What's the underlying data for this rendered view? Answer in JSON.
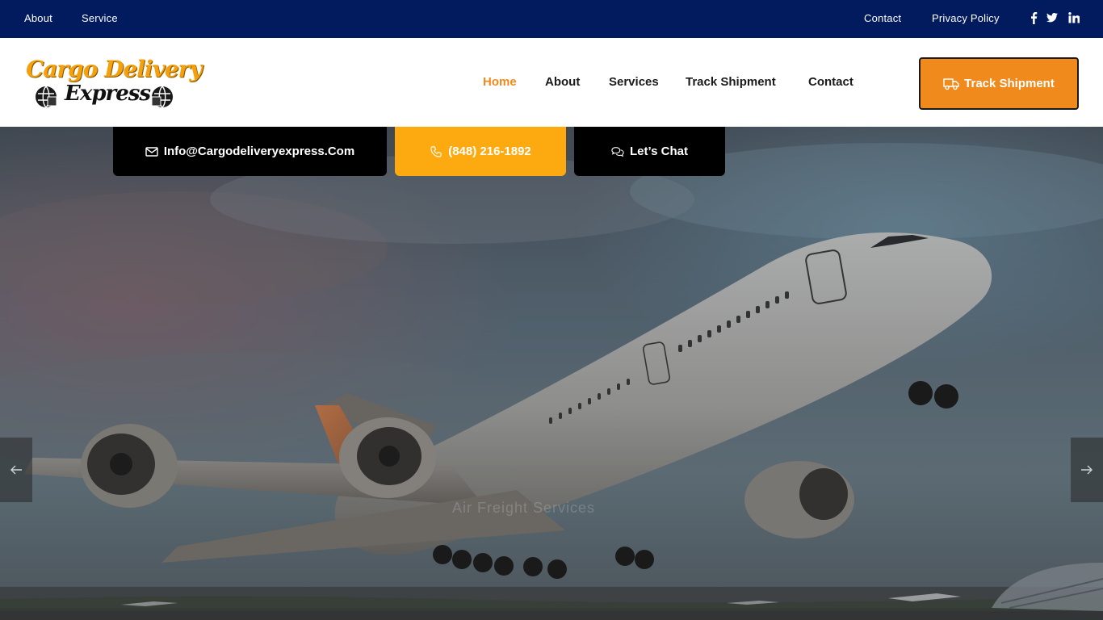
{
  "topbar": {
    "left_links": [
      "About",
      "Service"
    ],
    "right_links": [
      "Contact",
      "Privacy Policy"
    ],
    "social_icons": [
      "facebook-icon",
      "twitter-icon",
      "linkedin-icon"
    ],
    "bg_color": "#021b5e"
  },
  "logo": {
    "line1": "Cargo Delivery",
    "line2": "Express"
  },
  "nav": {
    "items": [
      {
        "label": "Home",
        "active": true
      },
      {
        "label": "About",
        "active": false
      },
      {
        "label": "Services",
        "active": false
      },
      {
        "label": "Track Shipment",
        "active": false
      },
      {
        "label": "Contact",
        "active": false
      }
    ],
    "accent_color": "#f08a1c"
  },
  "cta": {
    "track_label": "Track Shipment",
    "icon": "truck-icon"
  },
  "contact_bar": {
    "email": "Info@Cargodeliveryexpress.Com",
    "phone": "(848) 216-1892",
    "chat": "Let’s Chat",
    "email_icon": "envelope-icon",
    "phone_icon": "phone-icon",
    "chat_icon": "chat-bubbles-icon",
    "phone_bg": "#fdaa10"
  },
  "hero": {
    "caption": "Air Freight Services",
    "prev_icon": "arrow-left-icon",
    "next_icon": "arrow-right-icon"
  }
}
